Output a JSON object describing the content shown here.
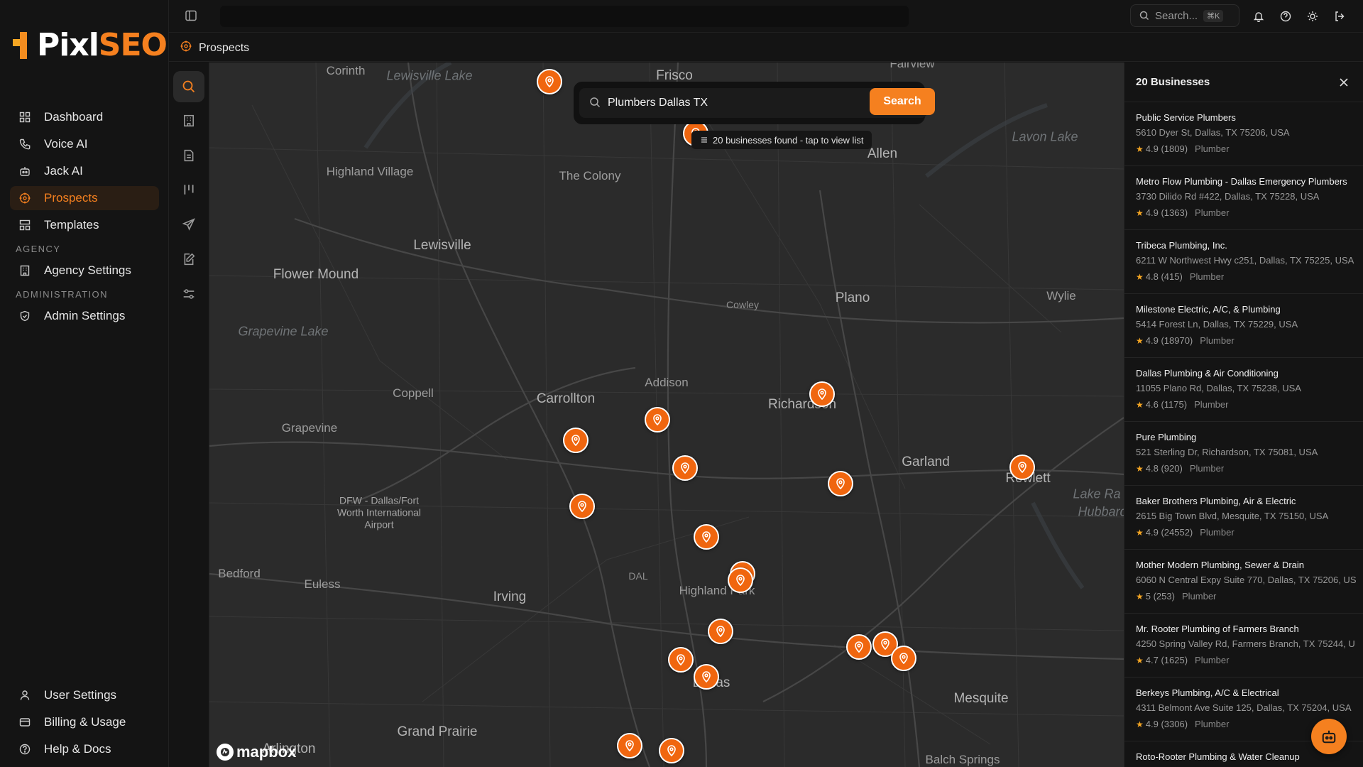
{
  "brand": {
    "name_part1": "Pixl",
    "name_part2": "SEO"
  },
  "sidebar": {
    "main_items": [
      {
        "label": "Dashboard",
        "icon": "grid-icon"
      },
      {
        "label": "Voice AI",
        "icon": "phone-icon"
      },
      {
        "label": "Jack AI",
        "icon": "robot-icon"
      },
      {
        "label": "Prospects",
        "icon": "target-icon",
        "active": true
      },
      {
        "label": "Templates",
        "icon": "layout-icon"
      }
    ],
    "agency_section": "AGENCY",
    "agency_items": [
      {
        "label": "Agency Settings",
        "icon": "building-icon"
      }
    ],
    "admin_section": "ADMINISTRATION",
    "admin_items": [
      {
        "label": "Admin Settings",
        "icon": "shield-icon"
      }
    ],
    "bottom_items": [
      {
        "label": "User Settings",
        "icon": "user-icon"
      },
      {
        "label": "Billing & Usage",
        "icon": "card-icon"
      },
      {
        "label": "Help & Docs",
        "icon": "help-icon"
      }
    ]
  },
  "topbar": {
    "search_placeholder": "Search...",
    "search_shortcut": "⌘K"
  },
  "breadcrumb": {
    "label": "Prospects"
  },
  "map": {
    "search_value": "Plumbers Dallas TX",
    "search_button": "Search",
    "found_chip": "20 businesses found - tap to view list",
    "attribution": "mapbox",
    "places": [
      {
        "name": "Frisco",
        "cls": "big"
      },
      {
        "name": "Fairview",
        "cls": ""
      },
      {
        "name": "Corinth",
        "cls": ""
      },
      {
        "name": "Lewisville Lake",
        "cls": "water"
      },
      {
        "name": "Lavon Lake",
        "cls": "water"
      },
      {
        "name": "Allen",
        "cls": "big"
      },
      {
        "name": "Highland Village",
        "cls": ""
      },
      {
        "name": "The Colony",
        "cls": ""
      },
      {
        "name": "Lewisville",
        "cls": "big"
      },
      {
        "name": "Flower Mound",
        "cls": "big"
      },
      {
        "name": "Plano",
        "cls": "big"
      },
      {
        "name": "Wylie",
        "cls": ""
      },
      {
        "name": "Cowley",
        "cls": "small"
      },
      {
        "name": "Grapevine Lake",
        "cls": "water"
      },
      {
        "name": "Addison",
        "cls": ""
      },
      {
        "name": "Coppell",
        "cls": ""
      },
      {
        "name": "Carrollton",
        "cls": "big"
      },
      {
        "name": "Richardson",
        "cls": "big"
      },
      {
        "name": "Garland",
        "cls": "big"
      },
      {
        "name": "Grapevine",
        "cls": ""
      },
      {
        "name": "Rowlett",
        "cls": "big"
      },
      {
        "name": "Lake Ra",
        "cls": "water"
      },
      {
        "name": "Hubbard",
        "cls": "water"
      },
      {
        "name": "DFW - Dallas/Fort Worth International Airport",
        "cls": "airport"
      },
      {
        "name": "Bedford",
        "cls": ""
      },
      {
        "name": "DAL",
        "cls": "small"
      },
      {
        "name": "Euless",
        "cls": ""
      },
      {
        "name": "Irving",
        "cls": "big"
      },
      {
        "name": "Highland Park",
        "cls": ""
      },
      {
        "name": "Dallas",
        "cls": "big"
      },
      {
        "name": "Mesquite",
        "cls": "big"
      },
      {
        "name": "Grand Prairie",
        "cls": "big"
      },
      {
        "name": "Arlington",
        "cls": "big"
      },
      {
        "name": "Balch Springs",
        "cls": ""
      }
    ]
  },
  "results": {
    "title": "20 Businesses",
    "businesses": [
      {
        "name": "Public Service Plumbers",
        "address": "5610 Dyer St, Dallas, TX 75206, USA",
        "rating": "4.9 (1809)",
        "category": "Plumber"
      },
      {
        "name": "Metro Flow Plumbing - Dallas Emergency Plumbers",
        "address": "3730 Dilido Rd #422, Dallas, TX 75228, USA",
        "rating": "4.9 (1363)",
        "category": "Plumber"
      },
      {
        "name": "Tribeca Plumbing, Inc.",
        "address": "6211 W Northwest Hwy c251, Dallas, TX 75225, USA",
        "rating": "4.8 (415)",
        "category": "Plumber"
      },
      {
        "name": "Milestone Electric, A/C, & Plumbing",
        "address": "5414 Forest Ln, Dallas, TX 75229, USA",
        "rating": "4.9 (18970)",
        "category": "Plumber"
      },
      {
        "name": "Dallas Plumbing & Air Conditioning",
        "address": "11055 Plano Rd, Dallas, TX 75238, USA",
        "rating": "4.6 (1175)",
        "category": "Plumber"
      },
      {
        "name": "Pure Plumbing",
        "address": "521 Sterling Dr, Richardson, TX 75081, USA",
        "rating": "4.8 (920)",
        "category": "Plumber"
      },
      {
        "name": "Baker Brothers Plumbing, Air & Electric",
        "address": "2615 Big Town Blvd, Mesquite, TX 75150, USA",
        "rating": "4.9 (24552)",
        "category": "Plumber"
      },
      {
        "name": "Mother Modern Plumbing, Sewer & Drain",
        "address": "6060 N Central Expy Suite 770, Dallas, TX 75206, US",
        "rating": "5 (253)",
        "category": "Plumber"
      },
      {
        "name": "Mr. Rooter Plumbing of Farmers Branch",
        "address": "4250 Spring Valley Rd, Farmers Branch, TX 75244, U",
        "rating": "4.7 (1625)",
        "category": "Plumber"
      },
      {
        "name": "Berkeys Plumbing, A/C & Electrical",
        "address": "4311 Belmont Ave Suite 125, Dallas, TX 75204, USA",
        "rating": "4.9 (3306)",
        "category": "Plumber"
      },
      {
        "name": "Roto-Rooter Plumbing & Water Cleanup",
        "address": "",
        "rating": "",
        "category": ""
      }
    ]
  },
  "colors": {
    "accent": "#f5801f",
    "pin": "#f0660f",
    "bg": "#141414",
    "map": "#2b2b2b"
  }
}
